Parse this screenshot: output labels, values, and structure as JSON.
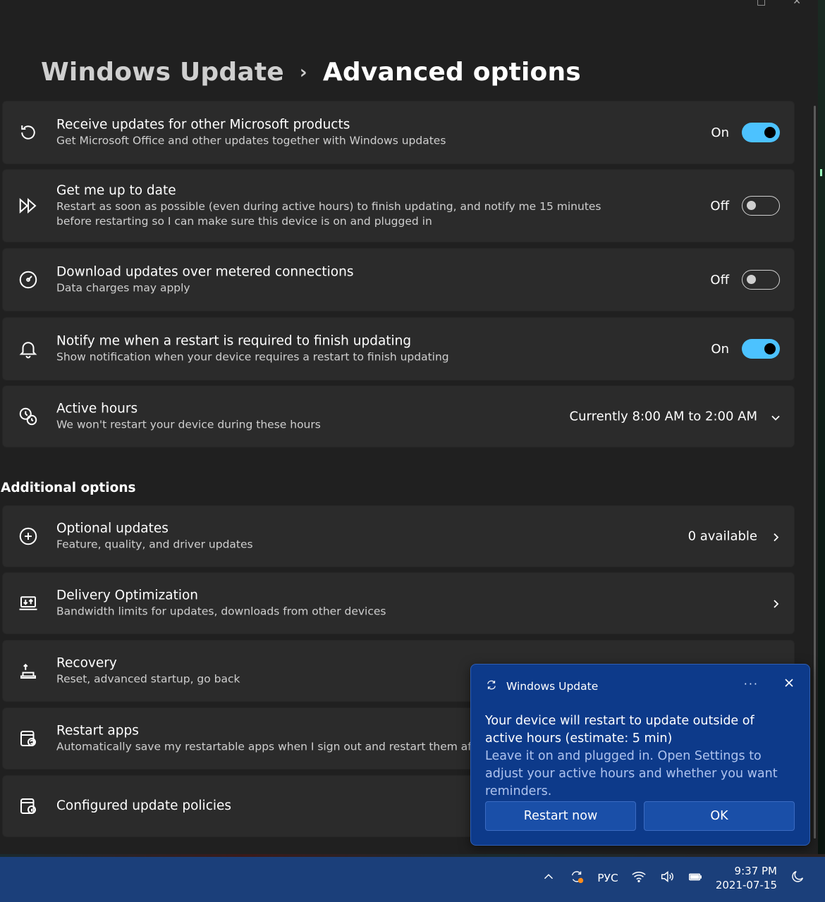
{
  "breadcrumb": {
    "parent": "Windows Update",
    "separator": "›",
    "current": "Advanced options"
  },
  "settings": [
    {
      "title": "Receive updates for other Microsoft products",
      "desc": "Get Microsoft Office and other updates together with Windows updates",
      "state": "On",
      "icon": "sync-icon"
    },
    {
      "title": "Get me up to date",
      "desc": "Restart as soon as possible (even during active hours) to finish updating, and notify me 15 minutes before restarting so I can make sure this device is on and plugged in",
      "state": "Off",
      "icon": "fast-forward-icon"
    },
    {
      "title": "Download updates over metered connections",
      "desc": "Data charges may apply",
      "state": "Off",
      "icon": "gauge-icon"
    },
    {
      "title": "Notify me when a restart is required to finish updating",
      "desc": "Show notification when your device requires a restart to finish updating",
      "state": "On",
      "icon": "bell-icon"
    },
    {
      "title": "Active hours",
      "desc": "We won't restart your device during these hours",
      "value": "Currently 8:00 AM to 2:00 AM",
      "icon": "clock-icon"
    }
  ],
  "additional_heading": "Additional options",
  "additional": [
    {
      "title": "Optional updates",
      "desc": "Feature, quality, and driver updates",
      "value": "0 available",
      "icon": "plus-circle-icon"
    },
    {
      "title": "Delivery Optimization",
      "desc": "Bandwidth limits for updates, downloads from other devices",
      "icon": "delivery-icon"
    },
    {
      "title": "Recovery",
      "desc": "Reset, advanced startup, go back",
      "icon": "recovery-icon"
    },
    {
      "title": "Restart apps",
      "desc": "Automatically save my restartable apps when I sign out and restart them after I sig",
      "icon": "restart-apps-icon"
    },
    {
      "title": "Configured update policies",
      "icon": "policy-icon"
    }
  ],
  "toast": {
    "app": "Windows Update",
    "more": "···",
    "primary": "Your device will restart to update outside of active hours (estimate: 5 min)",
    "secondary": "Leave it on and plugged in. Open Settings to adjust your active hours and whether you want reminders.",
    "button_restart": "Restart now",
    "button_ok": "OK"
  },
  "taskbar": {
    "language": "РУС",
    "time": "9:37 PM",
    "date": "2021-07-15"
  },
  "colors": {
    "accent": "#4cc2ff",
    "toast_bg": "#0d3a8a",
    "taskbar_bg": "#1b3f7a"
  }
}
